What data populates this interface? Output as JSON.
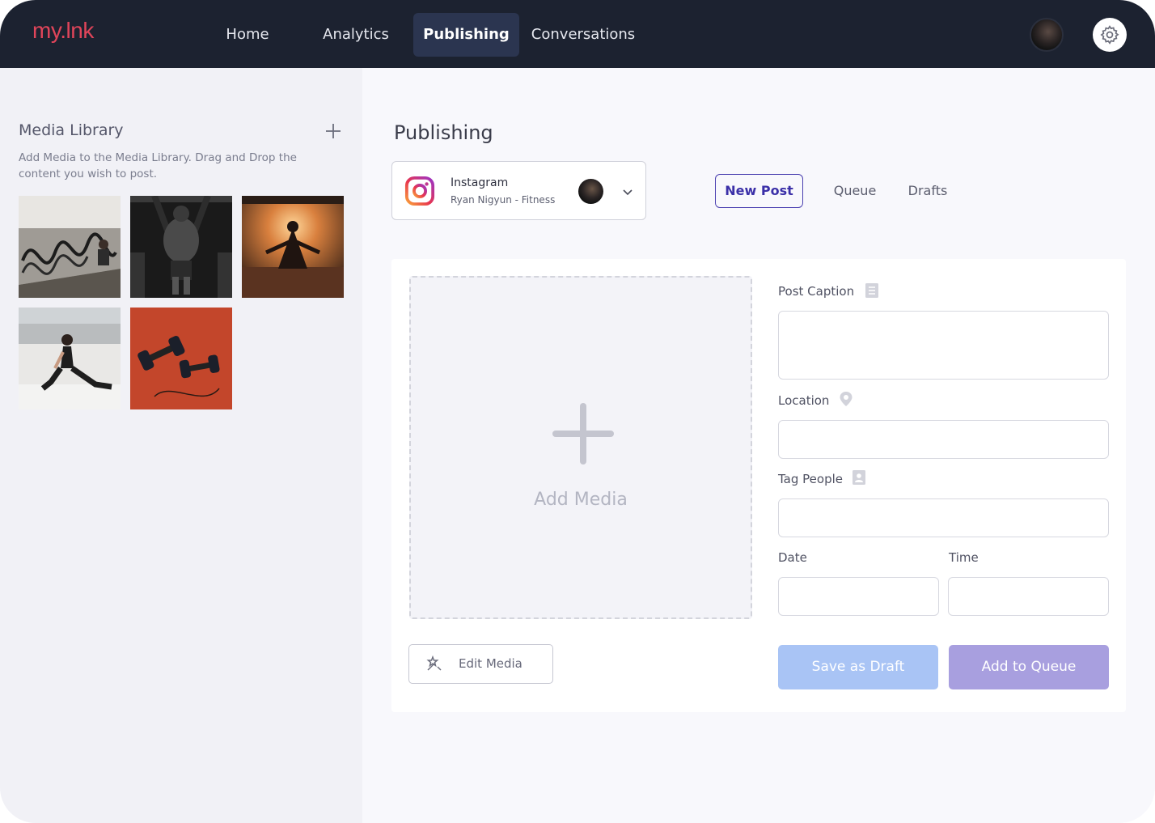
{
  "app": {
    "logo": "my.lnk",
    "nav": [
      {
        "label": "Home"
      },
      {
        "label": "Analytics"
      },
      {
        "label": "Publishing"
      },
      {
        "label": "Conversations"
      }
    ],
    "active_nav": "Publishing",
    "profile_icon": "user-avatar",
    "settings_icon": "gear-icon"
  },
  "sidebar": {
    "title": "Media Library",
    "add_icon": "plus-icon",
    "description": "Add Media to the Media Library. Drag and Drop the content you wish to post.",
    "thumbnails": [
      {
        "subject": "battle ropes"
      },
      {
        "subject": "pull-up athlete"
      },
      {
        "subject": "sunset yoga"
      },
      {
        "subject": "woman stretching"
      },
      {
        "subject": "dumbbells on track"
      }
    ]
  },
  "main": {
    "title": "Publishing",
    "account": {
      "platform": "Instagram",
      "name": "Ryan Nigyun - Fitness",
      "icon": "instagram-icon"
    },
    "tabs": [
      {
        "label": "New Post"
      },
      {
        "label": "Queue"
      },
      {
        "label": "Drafts"
      }
    ],
    "active_tab": "New Post",
    "dropzone": {
      "label": "Add Media"
    },
    "edit_media": {
      "label": "Edit Media",
      "icon": "magic-wand-icon"
    },
    "fields": {
      "caption": {
        "label": "Post Caption",
        "value": ""
      },
      "location": {
        "label": "Location",
        "value": ""
      },
      "tag_people": {
        "label": "Tag People",
        "value": ""
      },
      "date": {
        "label": "Date",
        "value": ""
      },
      "time": {
        "label": "Time",
        "value": ""
      }
    },
    "buttons": {
      "save_draft": "Save as Draft",
      "add_queue": "Add to Queue"
    }
  },
  "colors": {
    "topbar": "#1c2230",
    "logo": "#e0455a",
    "accent": "#3b30a8",
    "draft_button": "#a9c4f5",
    "queue_button": "#a89fdf"
  }
}
